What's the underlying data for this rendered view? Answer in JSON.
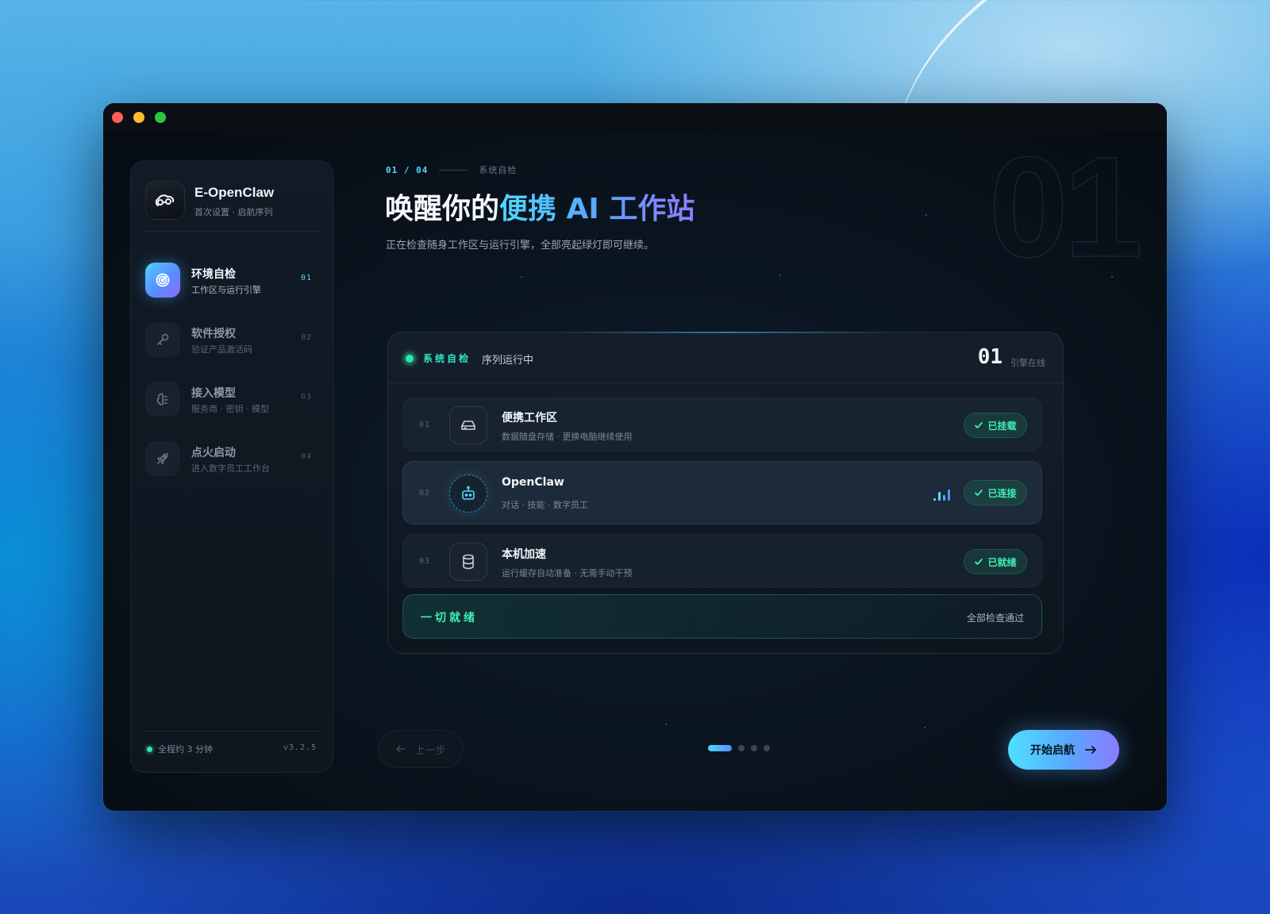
{
  "window": {
    "buttons": [
      "close",
      "minimize",
      "zoom"
    ]
  },
  "sidebar": {
    "brand_name": "E-OpenClaw",
    "brand_sub": "首次设置 · 启航序列",
    "brand_icon": "claw-logo-icon",
    "items": [
      {
        "title": "环境自检",
        "sub": "工作区与运行引擎",
        "num": "01",
        "icon": "radar-icon",
        "active": true
      },
      {
        "title": "软件授权",
        "sub": "验证产品激活码",
        "num": "02",
        "icon": "key-icon",
        "active": false
      },
      {
        "title": "接入模型",
        "sub": "服务商 · 密钥 · 模型",
        "num": "03",
        "icon": "brain-icon",
        "active": false
      },
      {
        "title": "点火启动",
        "sub": "进入数字员工工作台",
        "num": "04",
        "icon": "rocket-icon",
        "active": false
      }
    ],
    "footer_text": "全程约 3 分钟",
    "version": "v3.2.5"
  },
  "main": {
    "step_count": "01 / 04",
    "step_label": "系统自检",
    "big_number": "01",
    "headline_plain": "唤醒你的",
    "headline_accent": "便携 AI 工作站",
    "subhead": "正在检查随身工作区与运行引擎，全部亮起绿灯即可继续。"
  },
  "panel": {
    "title": "系统自检",
    "status": "序列运行中",
    "count": "01",
    "count_label": "引擎在线",
    "rows": [
      {
        "num": "01",
        "title": "便携工作区",
        "sub": "数据随盘存储 · 更换电脑继续使用",
        "badge": "已挂载",
        "icon": "drive-icon"
      },
      {
        "num": "02",
        "title": "OpenClaw",
        "sub": "对话 · 技能 · 数字员工",
        "badge": "已连接",
        "icon": "robot-icon"
      },
      {
        "num": "03",
        "title": "本机加速",
        "sub": "运行缓存自动准备 · 无需手动干预",
        "badge": "已就绪",
        "icon": "database-icon"
      }
    ],
    "ready_title": "一切就绪",
    "ready_note": "全部检查通过"
  },
  "footer": {
    "back_label": "上一步",
    "start_label": "开始启航",
    "pages": 4,
    "current_page": 1
  },
  "colors": {
    "accent_cyan": "#4fd8ff",
    "accent_blue": "#5a8cff",
    "accent_violet": "#8b7bff",
    "success": "#3ff0b4"
  }
}
